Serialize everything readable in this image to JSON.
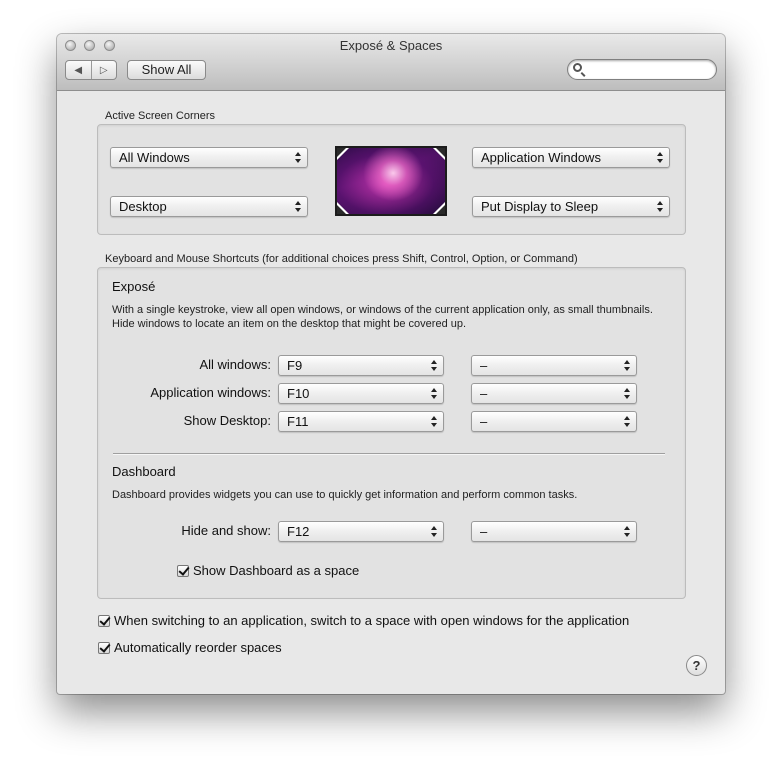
{
  "window": {
    "title": "Exposé & Spaces"
  },
  "toolbar": {
    "back": "◀",
    "forward": "▷",
    "show_all": "Show All",
    "search_placeholder": ""
  },
  "corners": {
    "section_label": "Active Screen Corners",
    "top_left": "All Windows",
    "bottom_left": "Desktop",
    "top_right": "Application Windows",
    "bottom_right": "Put Display to Sleep"
  },
  "shortcuts": {
    "section_label": "Keyboard and Mouse Shortcuts (for additional choices press Shift, Control, Option, or Command)",
    "expose": {
      "heading": "Exposé",
      "description": "With a single keystroke, view all open windows, or windows of the current application only, as small thumbnails. Hide windows to locate an item on the desktop that might be covered up.",
      "rows": [
        {
          "label": "All windows:",
          "key": "F9",
          "mouse": "–"
        },
        {
          "label": "Application windows:",
          "key": "F10",
          "mouse": "–"
        },
        {
          "label": "Show Desktop:",
          "key": "F11",
          "mouse": "–"
        }
      ]
    },
    "dashboard": {
      "heading": "Dashboard",
      "description": "Dashboard provides widgets you can use to quickly get information and perform common tasks.",
      "row": {
        "label": "Hide and show:",
        "key": "F12",
        "mouse": "–"
      },
      "checkbox_label": "Show Dashboard as a space",
      "checkbox_checked": true
    }
  },
  "options": {
    "switch_space": {
      "label": "When switching to an application, switch to a space with open windows for the application",
      "checked": true
    },
    "reorder_spaces": {
      "label": "Automatically reorder spaces",
      "checked": true
    }
  },
  "help": {
    "label": "?"
  }
}
